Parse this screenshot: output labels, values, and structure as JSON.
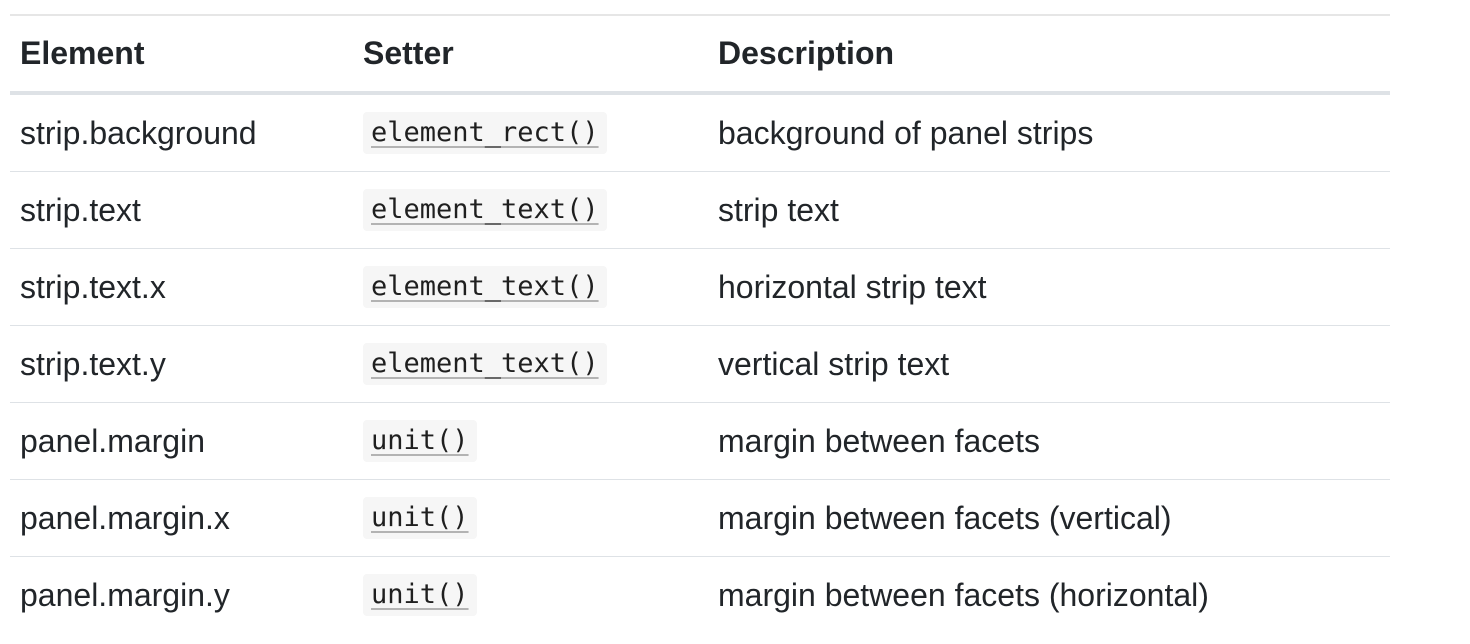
{
  "table": {
    "headers": [
      "Element",
      "Setter",
      "Description"
    ],
    "rows": [
      {
        "element": "strip.background",
        "setter": "element_rect()",
        "description": "background of panel strips"
      },
      {
        "element": "strip.text",
        "setter": "element_text()",
        "description": "strip text"
      },
      {
        "element": "strip.text.x",
        "setter": "element_text()",
        "description": "horizontal strip text"
      },
      {
        "element": "strip.text.y",
        "setter": "element_text()",
        "description": "vertical strip text"
      },
      {
        "element": "panel.margin",
        "setter": "unit()",
        "description": "margin between facets"
      },
      {
        "element": "panel.margin.x",
        "setter": "unit()",
        "description": "margin between facets (vertical)"
      },
      {
        "element": "panel.margin.y",
        "setter": "unit()",
        "description": "margin between facets (horizontal)"
      }
    ]
  },
  "colors": {
    "text": "#212529",
    "header_rule": "#dee2e6",
    "row_rule": "#dee2e6",
    "code_background": "#f6f6f6"
  }
}
